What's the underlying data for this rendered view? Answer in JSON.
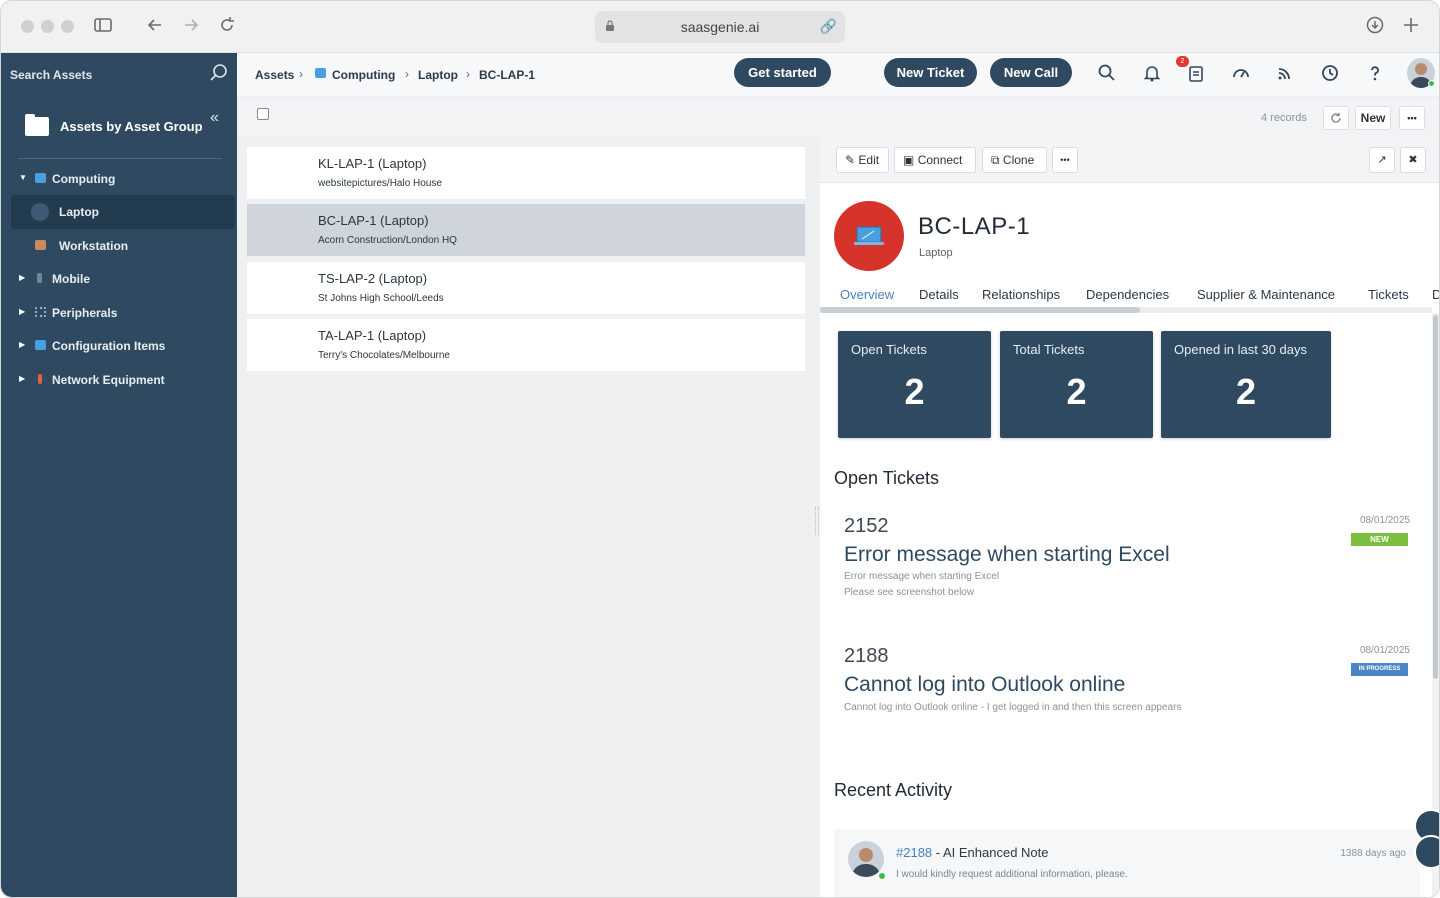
{
  "browser": {
    "url": "saasgenie.ai"
  },
  "sidebar": {
    "search_label": "Search Assets",
    "group_title": "Assets by Asset Group",
    "items": [
      {
        "label": "Computing",
        "expanded": true,
        "icon": "monitor-icon"
      },
      {
        "label": "Laptop",
        "active": true,
        "icon": "laptop-icon"
      },
      {
        "label": "Workstation",
        "icon": "workstation-icon"
      },
      {
        "label": "Mobile",
        "icon": "mobile-icon"
      },
      {
        "label": "Peripherals",
        "icon": "peripherals-icon"
      },
      {
        "label": "Configuration Items",
        "icon": "config-icon"
      },
      {
        "label": "Network Equipment",
        "icon": "network-icon"
      }
    ]
  },
  "breadcrumb": {
    "items": [
      "Assets",
      "Computing",
      "Laptop",
      "BC-LAP-1"
    ]
  },
  "header": {
    "get_started": "Get started",
    "new_ticket": "New Ticket",
    "new_call": "New Call",
    "notification_count": "2"
  },
  "toolbar": {
    "records": "4 records",
    "new_label": "New",
    "more_label": "•••"
  },
  "asset_list": [
    {
      "title": "KL-LAP-1 (Laptop)",
      "subtitle": "websitepictures/Halo House"
    },
    {
      "title": "BC-LAP-1 (Laptop)",
      "subtitle": "Acorn Construction/London HQ",
      "selected": true
    },
    {
      "title": "TS-LAP-2 (Laptop)",
      "subtitle": "St Johns High School/Leeds"
    },
    {
      "title": "TA-LAP-1 (Laptop)",
      "subtitle": "Terry's Chocolates/Melbourne"
    }
  ],
  "detail": {
    "actions": {
      "edit": "Edit",
      "connect": "Connect",
      "clone": "Clone",
      "more": "•••"
    },
    "name": "BC-LAP-1",
    "type": "Laptop",
    "tabs": [
      "Overview",
      "Details",
      "Relationships",
      "Dependencies",
      "Supplier & Maintenance",
      "Tickets",
      "D"
    ],
    "active_tab": "Overview",
    "stats": [
      {
        "label": "Open Tickets",
        "value": "2"
      },
      {
        "label": "Total Tickets",
        "value": "2"
      },
      {
        "label": "Opened in last 30 days",
        "value": "2"
      }
    ],
    "open_tickets_title": "Open Tickets",
    "tickets": [
      {
        "id": "2152",
        "title": "Error message when starting Excel",
        "desc1": "Error message when starting Excel",
        "desc2": "Please see screenshot below",
        "date": "08/01/2025",
        "status": "NEW",
        "status_color": "#7cbf3f"
      },
      {
        "id": "2188",
        "title": "Cannot log into Outlook online",
        "desc1": "Cannot log into Outlook online - I get logged in and then this screen appears",
        "desc2": "",
        "date": "08/01/2025",
        "status": "IN PROGRESS",
        "status_color": "#4a86c5"
      }
    ],
    "recent_activity_title": "Recent Activity",
    "activity": {
      "link": "#2188",
      "title": " - AI Enhanced Note",
      "desc": "I would kindly request additional information, please.",
      "time": "1388 days ago"
    }
  },
  "colors": {
    "sidebar_bg": "#2f4a60",
    "accent": "#4a7fbf",
    "avatar_red": "#d6332a"
  }
}
